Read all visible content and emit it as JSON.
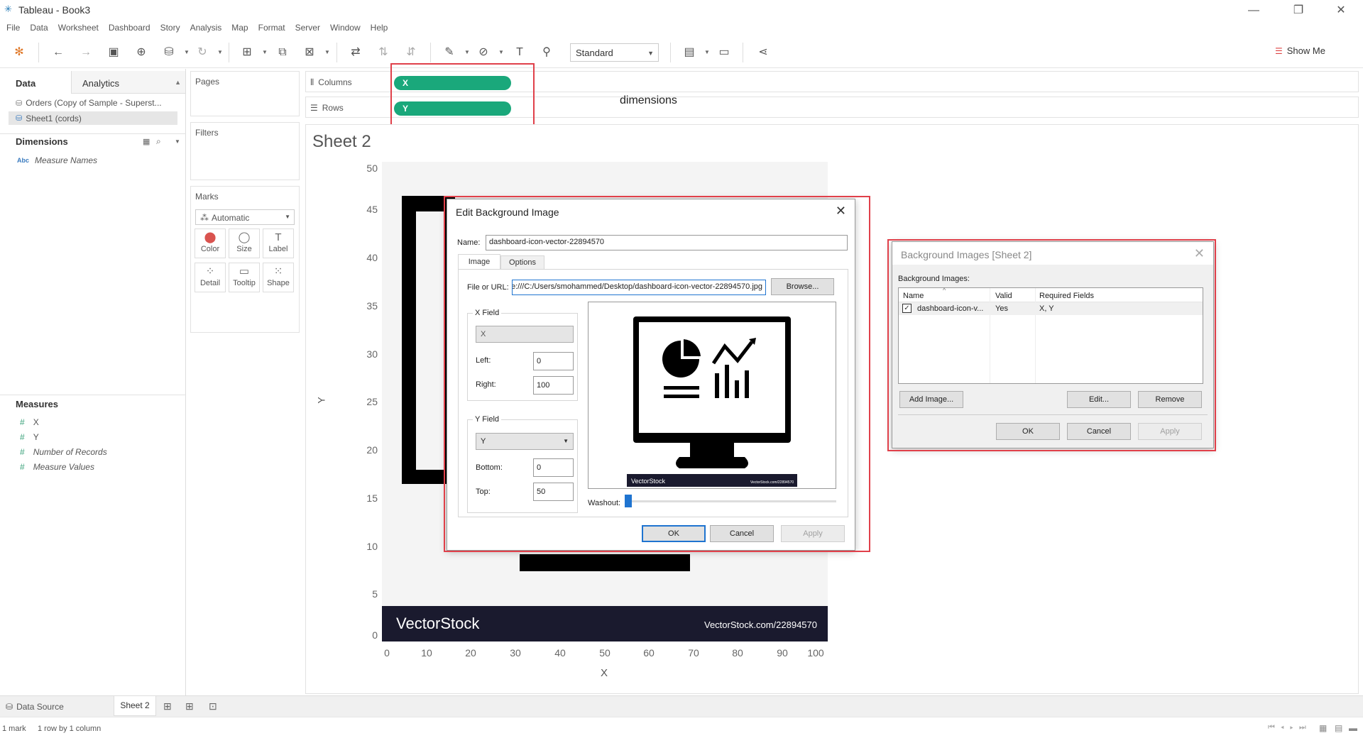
{
  "window": {
    "title": "Tableau - Book3",
    "min": "—",
    "max": "❐",
    "close": "✕"
  },
  "menu": [
    "File",
    "Data",
    "Worksheet",
    "Dashboard",
    "Story",
    "Analysis",
    "Map",
    "Format",
    "Server",
    "Window",
    "Help"
  ],
  "toolbar": {
    "fit_select": "Standard",
    "show_me": "Show Me"
  },
  "left_panel": {
    "tab_data": "Data",
    "tab_analytics": "Analytics",
    "datasources": [
      "Orders (Copy of Sample - Superst...",
      "Sheet1 (cords)"
    ],
    "dimensions_title": "Dimensions",
    "dimensions": [
      "Measure Names"
    ],
    "measures_title": "Measures",
    "measures": [
      "X",
      "Y",
      "Number of Records",
      "Measure Values"
    ]
  },
  "cards": {
    "pages": "Pages",
    "filters": "Filters",
    "marks": "Marks",
    "mark_type": "Automatic",
    "mark_buttons": [
      "Color",
      "Size",
      "Label",
      "Detail",
      "Tooltip",
      "Shape"
    ]
  },
  "shelves": {
    "columns_label": "Columns",
    "rows_label": "Rows",
    "columns_pill": "X",
    "rows_pill": "Y",
    "annotation": "dimensions"
  },
  "sheet": {
    "title": "Sheet 2",
    "y_axis_label": "Y",
    "x_axis_label": "X",
    "y_ticks": [
      "50",
      "45",
      "40",
      "35",
      "30",
      "25",
      "20",
      "15",
      "10",
      "5",
      "0"
    ],
    "x_ticks": [
      "0",
      "10",
      "20",
      "30",
      "40",
      "50",
      "60",
      "70",
      "80",
      "90",
      "100"
    ],
    "watermark_left": "VectorStock",
    "watermark_right": "VectorStock.com/22894570"
  },
  "edit_dialog": {
    "title": "Edit Background Image",
    "name_label": "Name:",
    "name_value": "dashboard-icon-vector-22894570",
    "tab_image": "Image",
    "tab_options": "Options",
    "file_label": "File or URL:",
    "file_value": "e:///C:/Users/smohammed/Desktop/dashboard-icon-vector-22894570.jpg",
    "browse": "Browse...",
    "x_field_title": "X Field",
    "x_field_value": "X",
    "left_label": "Left:",
    "left_value": "0",
    "right_label": "Right:",
    "right_value": "100",
    "y_field_title": "Y Field",
    "y_field_value": "Y",
    "bottom_label": "Bottom:",
    "bottom_value": "0",
    "top_label": "Top:",
    "top_value": "50",
    "washout_label": "Washout:",
    "washout_value": 0,
    "preview_footer_left": "VectorStock",
    "preview_footer_right": "VectorStock.com/22894570",
    "ok": "OK",
    "cancel": "Cancel",
    "apply": "Apply"
  },
  "bg_dialog": {
    "title": "Background Images [Sheet 2]",
    "list_label": "Background Images:",
    "col_name": "Name",
    "col_valid": "Valid",
    "col_required": "Required Fields",
    "rows": [
      {
        "name": "dashboard-icon-v...",
        "valid": "Yes",
        "required": "X, Y"
      }
    ],
    "add": "Add Image...",
    "edit": "Edit...",
    "remove": "Remove",
    "ok": "OK",
    "cancel": "Cancel",
    "apply": "Apply"
  },
  "bottom": {
    "data_source": "Data Source",
    "sheet_tab": "Sheet 2",
    "status_marks": "1 mark",
    "status_dims": "1 row by 1 column"
  }
}
